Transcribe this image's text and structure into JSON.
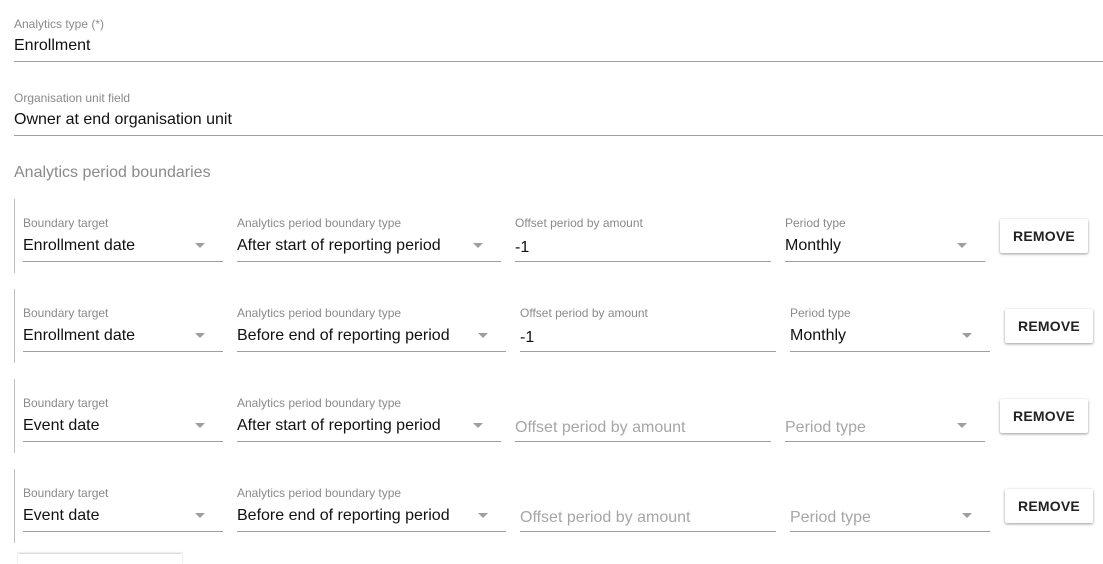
{
  "analytics_type": {
    "label": "Analytics type (*)",
    "value": "Enrollment"
  },
  "org_unit_field": {
    "label": "Organisation unit field",
    "value": "Owner at end organisation unit"
  },
  "section_title": "Analytics period boundaries",
  "columns": {
    "boundary_target": "Boundary target",
    "boundary_type": "Analytics period boundary type",
    "offset": "Offset period by amount",
    "period_type": "Period type"
  },
  "remove_label": "REMOVE",
  "rows": [
    {
      "boundary_target": "Enrollment date",
      "boundary_type": "After start of reporting period",
      "offset": "-1",
      "period_type": "Monthly"
    },
    {
      "boundary_target": "Enrollment date",
      "boundary_type": "Before end of reporting period",
      "offset": "-1",
      "period_type": "Monthly"
    },
    {
      "boundary_target": "Event date",
      "boundary_type": "After start of reporting period",
      "offset": "",
      "period_type": ""
    },
    {
      "boundary_target": "Event date",
      "boundary_type": "Before end of reporting period",
      "offset": "",
      "period_type": ""
    }
  ]
}
